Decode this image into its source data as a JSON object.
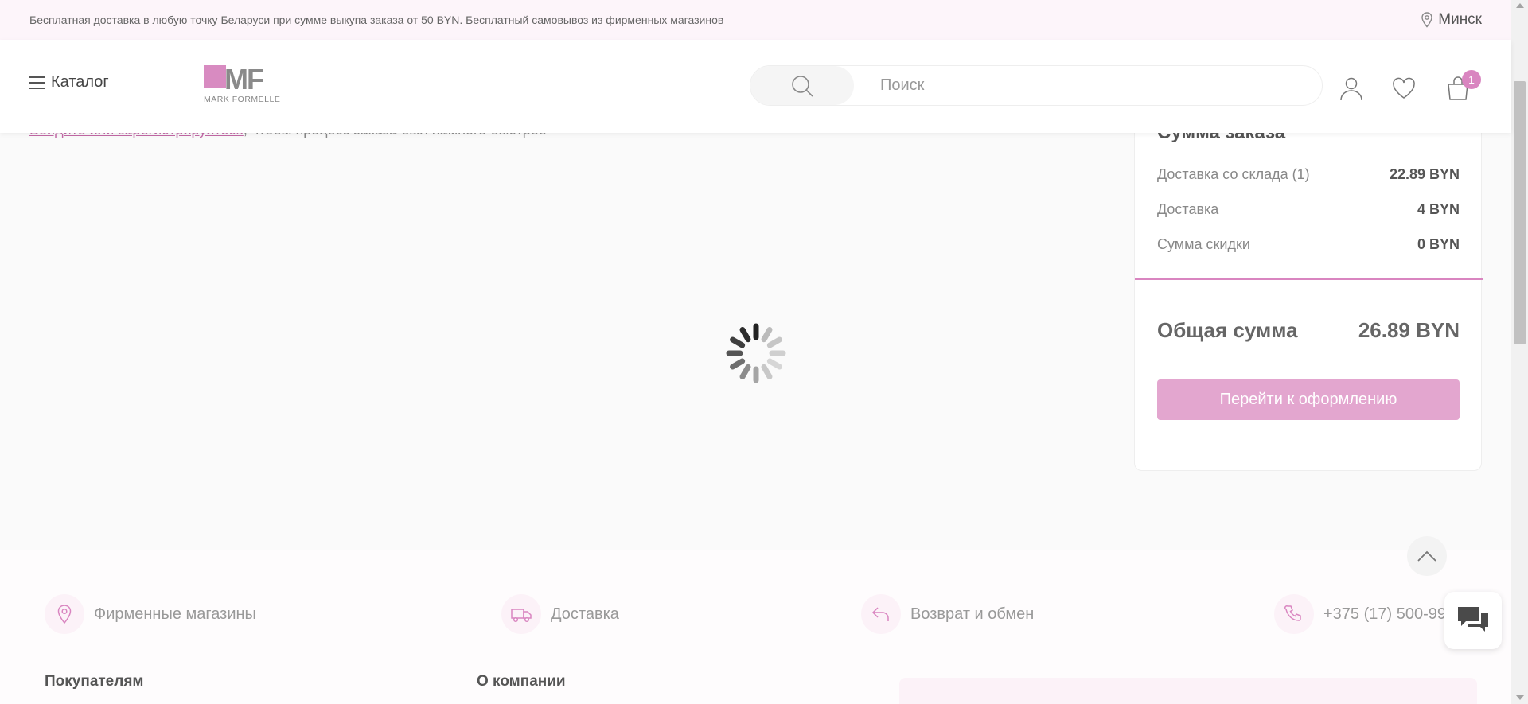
{
  "promo": {
    "text": "Бесплатная доставка в любую точку Беларуси при сумме выкупа заказа от 50 BYN. Бесплатный самовывоз из фирменных магазинов",
    "city": "Минск"
  },
  "header": {
    "catalog_label": "Каталог",
    "logo_letters": "MF",
    "logo_subtitle": "MARK FORMELLE",
    "search_placeholder": "Поиск",
    "cart_count": "1"
  },
  "main": {
    "login_link": "Войдите или зарегистрируйтесь",
    "login_rest": ", чтобы процесс заказа был намного быстрее"
  },
  "summary": {
    "title": "Сумма заказа",
    "rows": [
      {
        "label": "Доставка со склада (1)",
        "value": "22.89 BYN"
      },
      {
        "label": "Доставка",
        "value": "4 BYN"
      },
      {
        "label": "Сумма скидки",
        "value": "0 BYN"
      }
    ],
    "total_label": "Общая сумма",
    "total_value": "26.89 BYN",
    "checkout_label": "Перейти к оформлению"
  },
  "footer": {
    "items": [
      {
        "label": "Фирменные магазины",
        "icon": "location-pin-icon"
      },
      {
        "label": "Доставка",
        "icon": "truck-icon"
      },
      {
        "label": "Возврат и обмен",
        "icon": "return-arrow-icon"
      },
      {
        "label": "+375 (17) 500-99",
        "icon": "phone-icon"
      }
    ],
    "col1_title": "Покупателям",
    "col2_title": "О компании"
  },
  "colors": {
    "accent": "#d985c0",
    "button": "#e3a6cf",
    "promo_bg": "#fdf5fa"
  }
}
